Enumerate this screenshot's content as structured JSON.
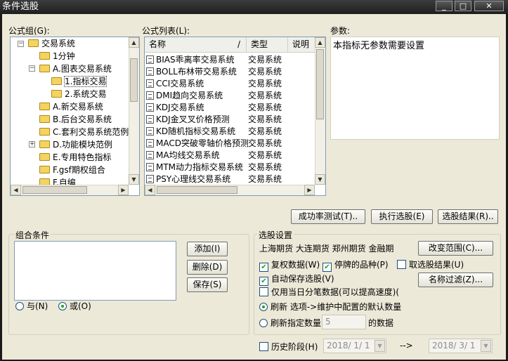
{
  "window": {
    "title": "条件选股",
    "controls": [
      "_",
      "□",
      "✕"
    ]
  },
  "groups_panel": {
    "label": "公式组(G):",
    "tree": [
      {
        "label": "交易系统",
        "expander": "−"
      },
      {
        "label": "1分钟"
      },
      {
        "label": "A.图表交易系统",
        "expander": "−"
      },
      {
        "label": "1.指标交易"
      },
      {
        "label": "2.系统交易"
      },
      {
        "label": "A.新交易系统"
      },
      {
        "label": "B.后台交易系统"
      },
      {
        "label": "C.套利交易系统范例"
      },
      {
        "label": "D.功能模块范例",
        "expander": "+"
      },
      {
        "label": "E.专用特色指标"
      },
      {
        "label": "F.gsf期权组合"
      },
      {
        "label": "F.自编"
      }
    ]
  },
  "formula_panel": {
    "label": "公式列表(L):",
    "columns": [
      "名称",
      "/",
      "类型",
      "说明"
    ],
    "rows": [
      {
        "name": "BIAS乖离率交易系统",
        "type": "交易系统"
      },
      {
        "name": "BOLL布林带交易系统",
        "type": "交易系统"
      },
      {
        "name": "CCI交易系统",
        "type": "交易系统"
      },
      {
        "name": "DMI趋向交易系统",
        "type": "交易系统"
      },
      {
        "name": "KDJ交易系统",
        "type": "交易系统"
      },
      {
        "name": "KDJ金叉叉价格预测",
        "type": "交易系统"
      },
      {
        "name": "KD随机指标交易系统",
        "type": "交易系统"
      },
      {
        "name": "MACD突破零轴价格预测",
        "type": "交易系统"
      },
      {
        "name": "MA均线交易系统",
        "type": "交易系统"
      },
      {
        "name": "MTM动力指标交易系统",
        "type": "交易系统"
      },
      {
        "name": "PSY心理线交易系统",
        "type": "交易系统"
      }
    ]
  },
  "params_panel": {
    "label": "参数:",
    "text": "本指标无参数需要设置"
  },
  "actions": {
    "success_test": "成功率测试(T)..",
    "run": "执行选股(E)",
    "results": "选股结果(R).."
  },
  "combo": {
    "label": "组合条件",
    "add": "添加(I)",
    "delete": "删除(D)",
    "save": "保存(S)",
    "and_label": "与(N)",
    "or_label": "或(O)"
  },
  "settings": {
    "label": "选股设置",
    "markets": "上海期货  大连期货  郑州期货  金融期",
    "change_range": "改变范围(C)...",
    "fuquan": "复权数据(W)",
    "suspended": "停牌的品种(P)",
    "take_result": "取选股结果(U)",
    "auto_save": "自动保存选股(V)",
    "intraday_only": "仅用当日分笔数据(可以提高速度)(",
    "name_filter": "名称过滤(Z)...",
    "refresh_default": "刷新  选项->维护中配置的默认数量",
    "refresh_count": "刷新指定数量",
    "count_value": "5",
    "count_suffix": "的数据",
    "history": "历史阶段(H)",
    "start_date": "2018/ 1/ 1",
    "arrow": "-->",
    "end_date": "2018/ 3/ 1"
  },
  "colors": {
    "title_bg": "#2b2b2b",
    "dialog_bg": "#ece9d8",
    "check_mark": "#21a121",
    "border": "#7f9db9"
  }
}
